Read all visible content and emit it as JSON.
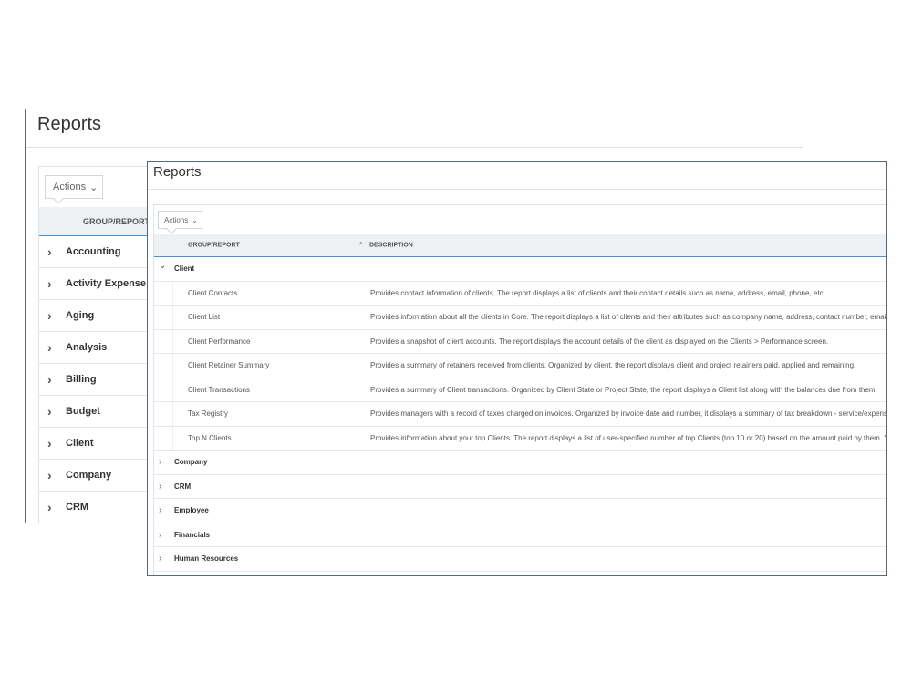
{
  "back": {
    "title": "Reports",
    "actions_label": "Actions",
    "column_group": "GROUP/REPORT",
    "groups": [
      "Accounting",
      "Activity Expense Items",
      "Aging",
      "Analysis",
      "Billing",
      "Budget",
      "Client",
      "Company",
      "CRM"
    ]
  },
  "front": {
    "title": "Reports",
    "actions_label": "Actions",
    "column_group": "GROUP/REPORT",
    "column_description": "DESCRIPTION",
    "sort_indicator": "^",
    "expanded_group": "Client",
    "reports": [
      {
        "name": "Client Contacts",
        "description": "Provides contact information of clients. The report displays a list of clients and their contact details such as name, address, email, phone, etc."
      },
      {
        "name": "Client List",
        "description": "Provides information about all the clients in Core. The report displays a list of clients and their attributes such as company name, address, contact number, email I"
      },
      {
        "name": "Client Performance",
        "description": "Provides a snapshot of client accounts. The report displays the account details of the client as displayed on the Clients > Performance screen."
      },
      {
        "name": "Client Retainer Summary",
        "description": "Provides a summary of retainers received from clients. Organized by client, the report displays client and project retainers paid, applied and remaining."
      },
      {
        "name": "Client Transactions",
        "description": "Provides a summary of Client transactions. Organized by Client State or Project State, the report displays a Client list along with the balances due from them."
      },
      {
        "name": "Tax Registry",
        "description": "Provides managers with a record of taxes charged on invoices. Organized by invoice date and number, it displays a summary of tax breakdown - service/expense"
      },
      {
        "name": "Top N Clients",
        "description": "Provides information about your top Clients. The report displays a list of user-specified number of top Clients (top 10 or 20) based on the amount paid by them. Y"
      }
    ],
    "groups": [
      "Company",
      "CRM",
      "Employee",
      "Financials",
      "Human Resources"
    ]
  }
}
